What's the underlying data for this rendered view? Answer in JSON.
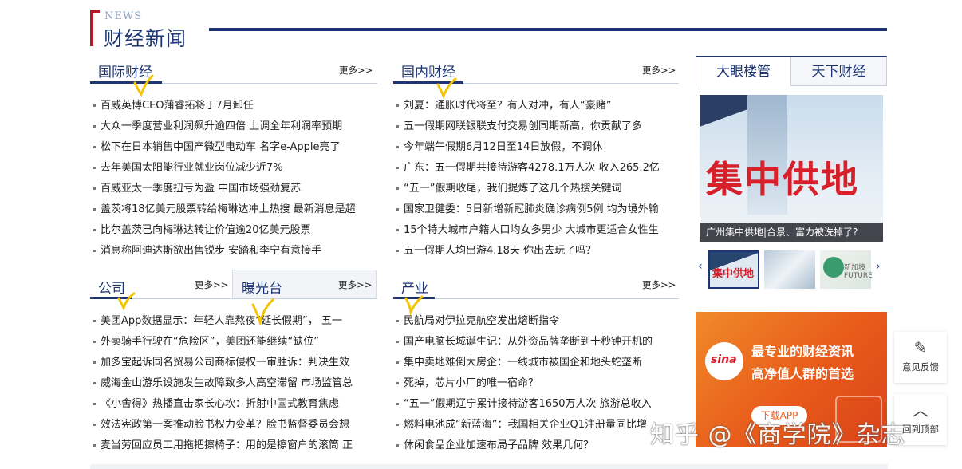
{
  "header": {
    "news_label": "NEWS",
    "title": "财经新闻"
  },
  "sections": {
    "international": {
      "title": "国际财经",
      "more": "更多>>",
      "items": [
        "百威英博CEO蒲睿拓将于7月卸任",
        "大众一季度营业利润飙升逾四倍 上调全年利润率预期",
        "松下在日本销售中国产微型电动车 名字e-Apple亮了",
        "去年美国太阳能行业就业岗位减少近7%",
        "百威亚太一季度扭亏为盈 中国市场强劲复苏",
        "盖茨将18亿美元股票转给梅琳达冲上热搜 最新消息是超",
        "比尔盖茨已向梅琳达转让价值逾20亿美元股票",
        "消息称阿迪达斯欲出售锐步 安踏和李宁有意接手"
      ]
    },
    "domestic": {
      "title": "国内财经",
      "more": "更多>>",
      "items": [
        "刘夏：通胀时代将至？有人对冲，有人“豪赌”",
        "五一假期网联银联支付交易创同期新高，你贡献了多",
        "今年端午假期6月12日至14日放假，不调休",
        "广东：五一假期共接待游客4278.1万人次 收入265.2亿",
        "“五一”假期收尾，我们提炼了这几个热搜关键词",
        "国家卫健委：5日新增新冠肺炎确诊病例5例 均为境外输",
        "15个特大城市户籍人口均女多男少 大城市更适合女性生",
        "五一假期人均出游4.18天 你出去玩了吗？"
      ]
    },
    "company": {
      "title": "公司",
      "more": "更多>>",
      "tab2": "曝光台",
      "more2": "更多>>",
      "items": [
        "美团App数据显示：年轻人靠熬夜“延长假期”， 五一",
        "外卖骑手行驶在“危险区”，美团还能继续“缺位”",
        "加多宝起诉同名贸易公司商标侵权一审胜诉：判决生效",
        "威海金山游乐设施发生故障致多人高空滞留 市场监管总",
        "《小舍得》热播直击家长心坎：折射中国式教育焦虑",
        "效法宪政第一案推动脸书权力变革？脸书监督委员会想",
        "麦当劳回应员工用拖把擦椅子：用的是擦窗户的滚筒 正"
      ]
    },
    "industry": {
      "title": "产业",
      "more": "更多>>",
      "items": [
        "民航局对伊拉克航空发出熔断指令",
        "国产电脑长城诞生记：从外资品牌垄断到十秒钟开机的",
        "集中卖地难倒大房企：一线城市被国企和地头蛇垄断",
        "死掉，芯片小厂的唯一宿命？",
        "“五一”假期辽宁累计接待游客1650万人次 旅游总收入",
        "燃料电池成“新蓝海”：我国相关企业Q1注册量同比增",
        "休闲食品企业加速布局子品牌 效果几何？"
      ]
    }
  },
  "right": {
    "tabs": [
      "大眼楼管",
      "天下财经"
    ],
    "promo_text": "集中供地",
    "promo_caption": "广州集中供地|合景、富力被洗掉了?",
    "thumb1_text": "集中供地",
    "thumb3_text": "新加坡 FUTURE",
    "ad": {
      "logo": "sina",
      "line1": "最专业的财经资讯",
      "line2": "高净值人群的首选",
      "button": "下载APP"
    }
  },
  "float": {
    "feedback": "意见反馈",
    "top": "回到顶部"
  },
  "watermark": "知乎 @《商学院》杂志",
  "colors": {
    "brand": "#1d3575",
    "accent": "#b3182a",
    "ad": "#e85a1a",
    "check": "#f5c400"
  }
}
